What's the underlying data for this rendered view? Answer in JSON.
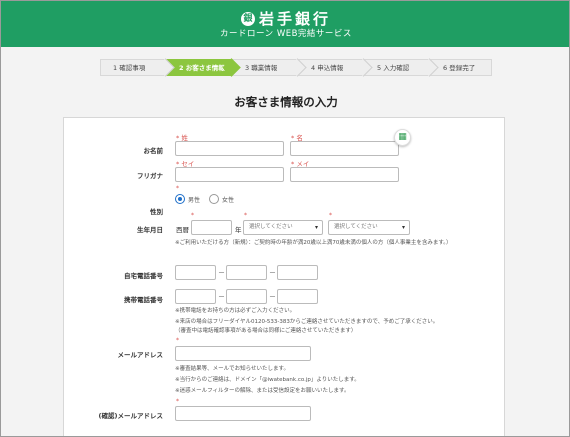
{
  "header": {
    "logo_mark": "銀",
    "bank_name": "岩手銀行",
    "subtitle": "カードローン WEB完結サービス",
    "color": "#1f9e63"
  },
  "steps": [
    {
      "label": "1 確認事項",
      "active": false
    },
    {
      "label": "2 お客さま情報",
      "active": true
    },
    {
      "label": "3 職業情報",
      "active": false
    },
    {
      "label": "4 申込情報",
      "active": false
    },
    {
      "label": "5 入力確認",
      "active": false
    },
    {
      "label": "6 登録完了",
      "active": false
    }
  ],
  "page_title": "お客さま情報の入力",
  "form": {
    "name": {
      "label": "お名前",
      "sei_label": "* 姓",
      "mei_label": "* 名",
      "sei_value": "",
      "mei_value": ""
    },
    "furigana": {
      "label": "フリガナ",
      "sei_label": "* セイ",
      "mei_label": "* メイ",
      "sei_value": "",
      "mei_value": ""
    },
    "gender": {
      "label": "性別",
      "required_mark": "*",
      "options": [
        "男性",
        "女性"
      ],
      "selected": "男性"
    },
    "birthday": {
      "label": "生年月日",
      "required_mark": "*",
      "era_label": "西暦",
      "year_unit": "年",
      "month_placeholder": "選択してください",
      "day_placeholder": "選択してください",
      "note": "※ご利用いただける方（新規）：ご契約時の年齢が満20歳以上満70歳未満の個人の方（個人事業主を含みます。）"
    },
    "home_phone": {
      "label": "自宅電話番号",
      "dash": "－"
    },
    "mobile_phone": {
      "label": "携帯電話番号",
      "dash": "－",
      "notes": [
        "※携帯電話をお持ちの方は必ずご入力ください。",
        "※来店の場合はフリーダイヤル0120-533-383からご連絡させていただきますので、予めご了承ください。",
        "（審査中は電話確認事項がある場合は同様にご連絡させていただきます）"
      ]
    },
    "email": {
      "label": "メールアドレス",
      "required_mark": "*",
      "notes": [
        "※審査結果等、メールでお知らせいたします。",
        "※当行からのご連絡は、ドメイン「@iwatebank.co.jp」よりいたします。",
        "※迷惑メールフィルターの解除、または受信設定をお願いいたします。"
      ]
    },
    "email_confirm": {
      "label": "(確認)メールアドレス",
      "required_mark": "*"
    },
    "keyboard_icon": "keyboard-icon"
  }
}
